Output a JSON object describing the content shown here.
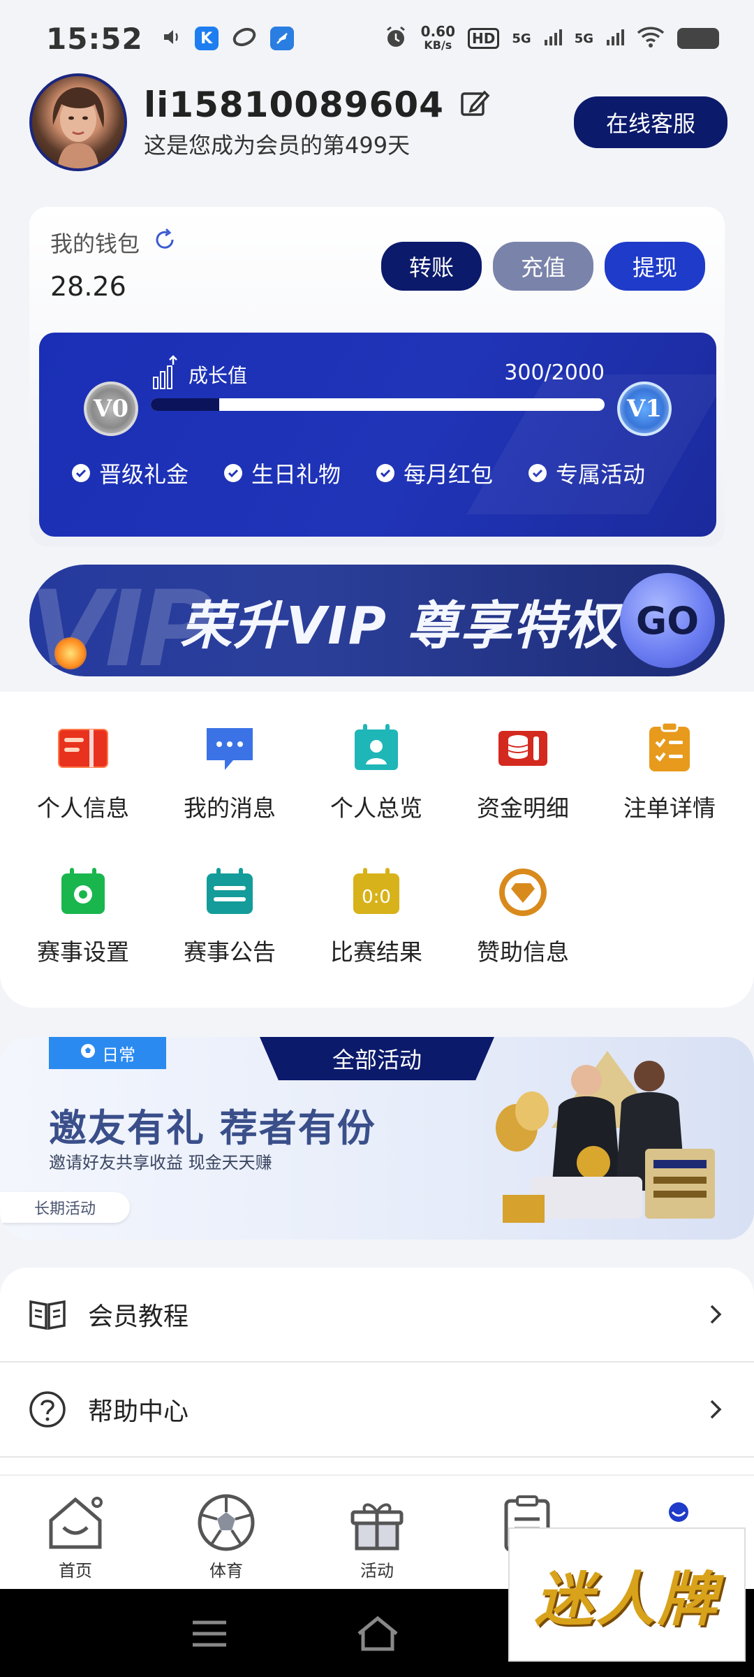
{
  "status_bar": {
    "time": "15:52",
    "net_speed_value": "0.60",
    "net_speed_unit": "KB/s",
    "hd": "HD",
    "signal_1": "5G",
    "signal_2": "5G"
  },
  "header": {
    "username": "li15810089604",
    "member_days": "这是您成为会员的第499天",
    "service_button": "在线客服"
  },
  "wallet": {
    "label": "我的钱包",
    "balance": "28.26",
    "actions": {
      "transfer": "转账",
      "deposit": "充值",
      "withdraw": "提现"
    }
  },
  "vip": {
    "growth_label": "成长值",
    "growth_value": "300/2000",
    "progress_fraction": 0.15,
    "current_level": "V0",
    "next_level": "V1",
    "perks": [
      "晋级礼金",
      "生日礼物",
      "每月红包",
      "专属活动"
    ],
    "banner_text": "荣升VIP 尊享特权",
    "banner_ghost": "VIP",
    "go_label": "GO"
  },
  "menu": {
    "items": [
      {
        "label": "个人信息",
        "icon": "id-card-icon",
        "color": "#e8321e"
      },
      {
        "label": "我的消息",
        "icon": "message-icon",
        "color": "#3b72e6"
      },
      {
        "label": "个人总览",
        "icon": "profile-calendar-icon",
        "color": "#1fb6b8"
      },
      {
        "label": "资金明细",
        "icon": "coins-icon",
        "color": "#d3291f"
      },
      {
        "label": "注单详情",
        "icon": "checklist-icon",
        "color": "#e79a1b"
      },
      {
        "label": "赛事设置",
        "icon": "calendar-gear-icon",
        "color": "#19b64e"
      },
      {
        "label": "赛事公告",
        "icon": "calendar-list-icon",
        "color": "#139c9a"
      },
      {
        "label": "比赛结果",
        "icon": "scoreboard-icon",
        "color": "#d8b21a"
      },
      {
        "label": "赞助信息",
        "icon": "sponsor-diamond-icon",
        "color": "#d98a1c"
      }
    ]
  },
  "activity": {
    "tab_label": "全部活动",
    "daily_tag": "日常",
    "title": "邀友有礼  荐者有份",
    "subtitle": "邀请好友共享收益  现金天天赚",
    "long_term_tag": "长期活动"
  },
  "list": {
    "items": [
      {
        "label": "会员教程",
        "icon": "book-icon"
      },
      {
        "label": "帮助中心",
        "icon": "help-icon"
      }
    ]
  },
  "bottom_nav": {
    "items": [
      {
        "label": "首页",
        "icon": "home-icon"
      },
      {
        "label": "体育",
        "icon": "football-icon"
      },
      {
        "label": "活动",
        "icon": "gift-icon"
      },
      {
        "label": "",
        "icon": "clipboard-icon"
      },
      {
        "label": "",
        "icon": "profile-icon"
      }
    ]
  },
  "watermark": {
    "text": "迷人牌"
  },
  "colors": {
    "navy": "#0b1a6b",
    "vip_blue": "#2034b8",
    "accent_blue": "#1f3bc9"
  }
}
